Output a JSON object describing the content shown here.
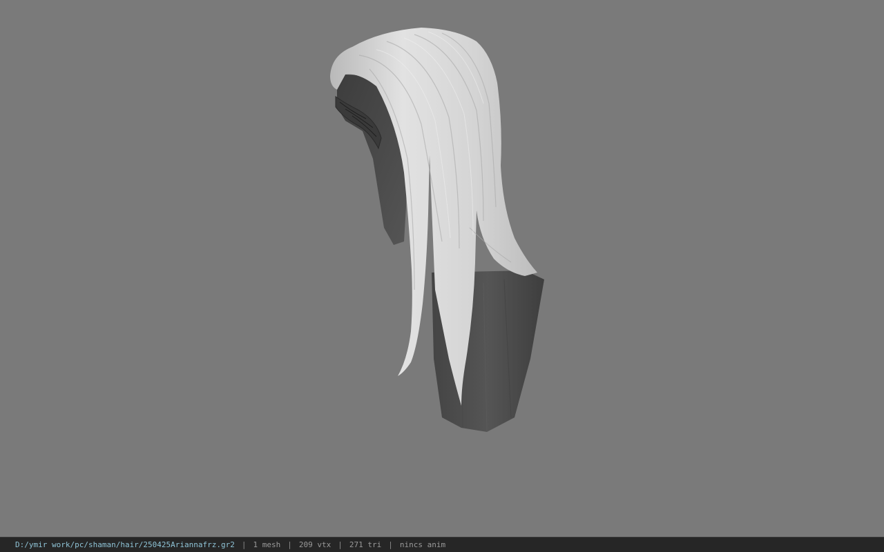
{
  "viewport": {
    "background_color": "#7a7a7a",
    "model": "hair-mesh",
    "hair_color": "#d8d8d8",
    "back_surface_color": "#4d4d4d"
  },
  "status_bar": {
    "file_path": "D:/ymir work/pc/shaman/hair/250425Ariannafrz.gr2",
    "mesh_count": "1 mesh",
    "vertex_count": "209 vtx",
    "triangle_count": "271 tri",
    "anim_status": "nincs anim",
    "separator": "|"
  }
}
